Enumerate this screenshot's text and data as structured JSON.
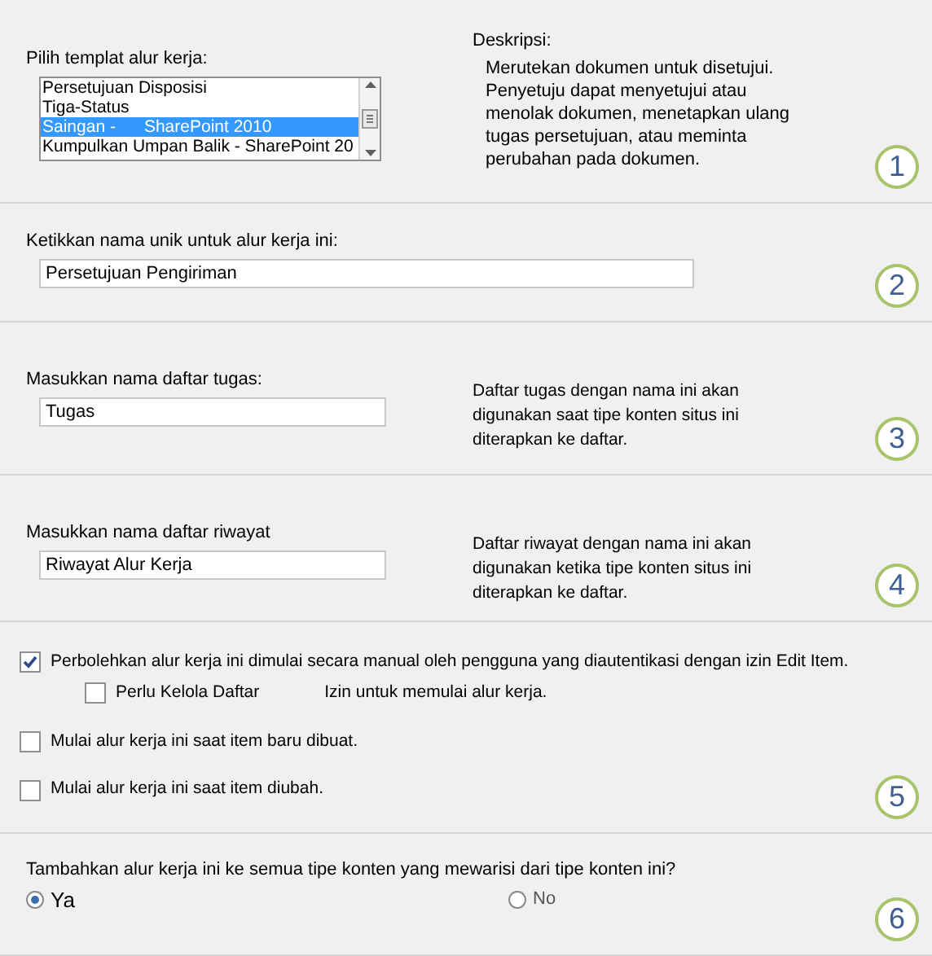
{
  "sections": [
    {
      "kind": "template",
      "step": "1",
      "label": "Pilih templat alur kerja:",
      "items": [
        {
          "label": "Persetujuan Disposisi",
          "selected": false
        },
        {
          "label": "Tiga-Status",
          "selected": false
        },
        {
          "label": "Saingan -      SharePoint 2010",
          "selected": true
        },
        {
          "label": "Kumpulkan Umpan Balik - SharePoint 20",
          "selected": false
        }
      ],
      "description_title": "Deskripsi:",
      "description": "Merutekan dokumen untuk disetujui. Penyetuju dapat menyetujui atau menolak dokumen, menetapkan ulang tugas persetujuan, atau meminta perubahan pada dokumen."
    },
    {
      "kind": "text",
      "step": "2",
      "label": "Ketikkan nama unik untuk alur kerja ini:",
      "value": "Persetujuan Pengiriman"
    },
    {
      "kind": "list",
      "step": "3",
      "label": "Masukkan nama daftar tugas:",
      "value": "Tugas",
      "note": "Daftar tugas dengan nama ini akan digunakan saat tipe konten situs ini diterapkan ke daftar."
    },
    {
      "kind": "list",
      "step": "4",
      "label": "Masukkan nama daftar riwayat",
      "value": "Riwayat Alur Kerja",
      "note": "Daftar riwayat dengan nama ini akan digunakan ketika tipe konten situs ini diterapkan ke daftar."
    },
    {
      "kind": "options",
      "step": "5",
      "options": [
        {
          "label": "Perbolehkan alur kerja ini dimulai secara manual oleh pengguna yang diautentikasi dengan izin Edit Item.",
          "checked": true,
          "sub": {
            "label": "Perlu Kelola Daftar",
            "note": "Izin untuk memulai alur kerja.",
            "checked": false
          }
        },
        {
          "label": "Mulai alur kerja ini saat item baru dibuat.",
          "checked": false
        },
        {
          "label": "Mulai alur kerja ini saat item diubah.",
          "checked": false
        }
      ]
    },
    {
      "kind": "radio",
      "step": "6",
      "label": "Tambahkan alur kerja ini ke semua tipe konten yang mewarisi dari tipe konten ini?",
      "choices": [
        {
          "label": "Ya",
          "selected": true
        },
        {
          "label": "No",
          "selected": false
        }
      ]
    }
  ]
}
